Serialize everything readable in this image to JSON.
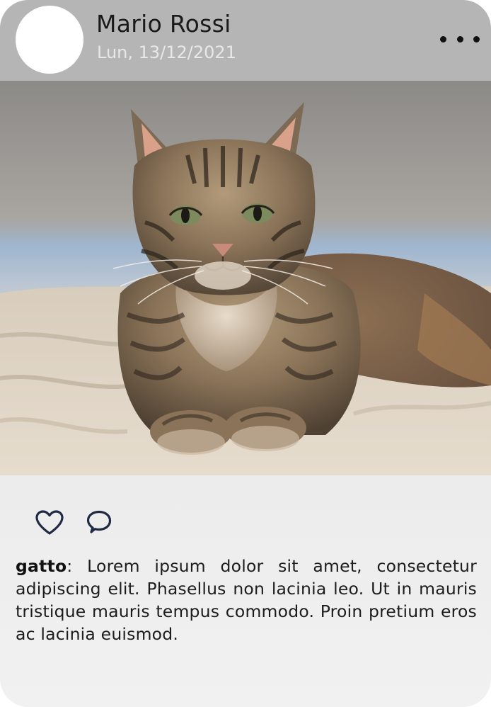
{
  "post": {
    "author": "Mario Rossi",
    "date": "Lun, 13/12/2021",
    "caption_user": "gatto",
    "caption_separator": ":",
    "caption_text": " Lorem ipsum dolor sit amet, consectetur adipiscing elit. Phasellus non lacinia leo. Ut in mauris tristique mauris tempus commodo. Proin pretium eros ac lacinia euismod."
  },
  "icons": {
    "menu": "more-dots-icon",
    "like": "heart-icon",
    "comment": "comment-bubble-icon"
  },
  "colors": {
    "header_bg": "#b5b5b5",
    "icon_stroke": "#1f2a44",
    "avatar_bg": "#ffffff"
  }
}
